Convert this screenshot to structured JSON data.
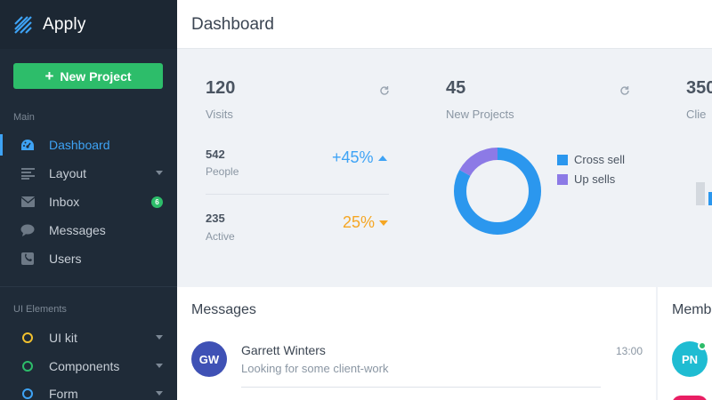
{
  "sidebar": {
    "brand": "Apply",
    "new_project": "New Project",
    "main_label": "Main",
    "items": [
      {
        "label": "Dashboard",
        "icon": "dashboard-icon"
      },
      {
        "label": "Layout",
        "icon": "layout-icon"
      },
      {
        "label": "Inbox",
        "icon": "inbox-icon",
        "badge": "6"
      },
      {
        "label": "Messages",
        "icon": "chat-icon"
      },
      {
        "label": "Users",
        "icon": "users-icon"
      }
    ],
    "ui_label": "UI Elements",
    "ui_items": [
      {
        "label": "UI kit",
        "color": "#f2c12e"
      },
      {
        "label": "Components",
        "color": "#2dbd6a"
      },
      {
        "label": "Form",
        "color": "#3ea3f5"
      }
    ]
  },
  "header": {
    "title": "Dashboard"
  },
  "stats": {
    "visits": {
      "value": "120",
      "label": "Visits"
    },
    "people": {
      "value": "542",
      "label": "People",
      "change": "+45%",
      "color": "#3ea3f5"
    },
    "active": {
      "value": "235",
      "label": "Active",
      "change": "25%",
      "color": "#f5a623"
    },
    "projects": {
      "value": "45",
      "label": "New Projects"
    },
    "clients": {
      "value": "350",
      "label": "Clie"
    }
  },
  "chart_data": {
    "type": "pie",
    "categories": [
      "Cross sell",
      "Up sells"
    ],
    "values": [
      83,
      17
    ],
    "colors": [
      "#2b97ee",
      "#8c7ae6"
    ],
    "legend": "right"
  },
  "messages": {
    "title": "Messages",
    "items": [
      {
        "initials": "GW",
        "name": "Garrett Winters",
        "text": "Looking for some client-work",
        "time": "13:00",
        "color": "#3f51b5"
      }
    ]
  },
  "members": {
    "title": "Memb",
    "items": [
      {
        "initials": "PN",
        "color": "#1fbcd2",
        "online_color": "#2dbd6a"
      }
    ]
  }
}
